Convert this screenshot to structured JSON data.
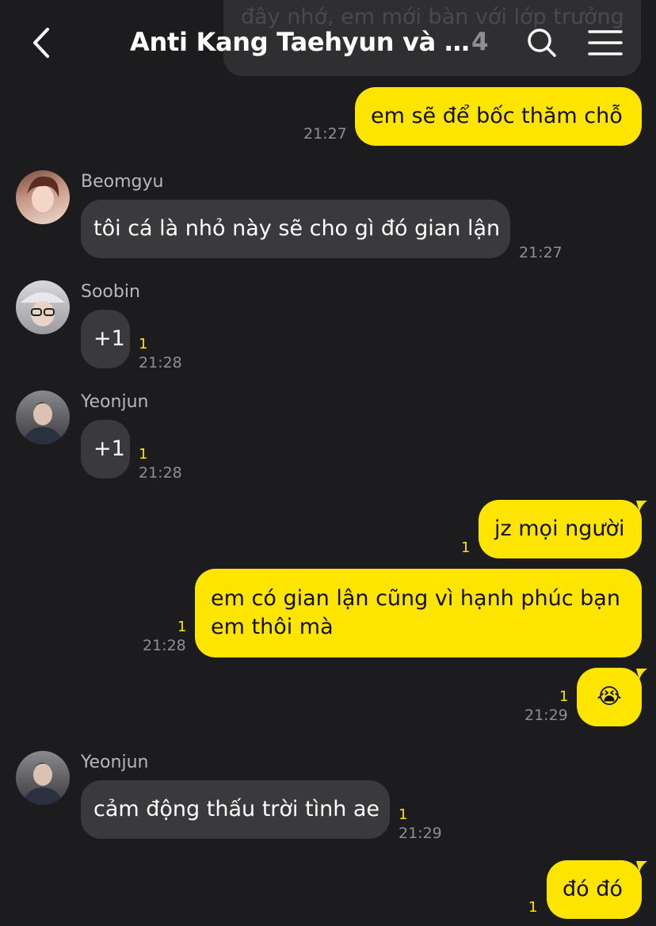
{
  "header": {
    "title": "Anti Kang Taehyun và Ha...",
    "member_count": "4",
    "back_icon": "chevron-left-icon",
    "search_icon": "search-icon",
    "menu_icon": "menu-icon"
  },
  "previous_message": {
    "text": "đây nhớ, em mới bàn với lớp trưởng"
  },
  "messages": [
    {
      "from": "me",
      "text": "em sẽ để bốc thăm chỗ",
      "time": "21:27"
    },
    {
      "from": "Beomgyu",
      "text": "tôi cá là nhỏ này sẽ cho gì đó gian lận",
      "time": "21:27"
    },
    {
      "from": "Soobin",
      "text": "+1",
      "unread": "1",
      "time": "21:28"
    },
    {
      "from": "Yeonjun",
      "text": "+1",
      "unread": "1",
      "time": "21:28"
    },
    {
      "from": "me",
      "text": "jz mọi người",
      "unread": "1"
    },
    {
      "from": "me",
      "text": "em có gian lận cũng vì hạnh phúc bạn em thôi mà",
      "unread": "1",
      "time": "21:28"
    },
    {
      "from": "me",
      "text": "😭",
      "unread": "1",
      "time": "21:29"
    },
    {
      "from": "Yeonjun",
      "text": "cảm động thấu trời tình ae",
      "unread": "1",
      "time": "21:29"
    },
    {
      "from": "me",
      "text": "đó đó",
      "unread": "1"
    }
  ],
  "colors": {
    "background": "#1c1c1e",
    "my_bubble": "#fee500",
    "their_bubble": "#3a3a3c",
    "unread": "#fee500",
    "time": "#8e8e93"
  }
}
